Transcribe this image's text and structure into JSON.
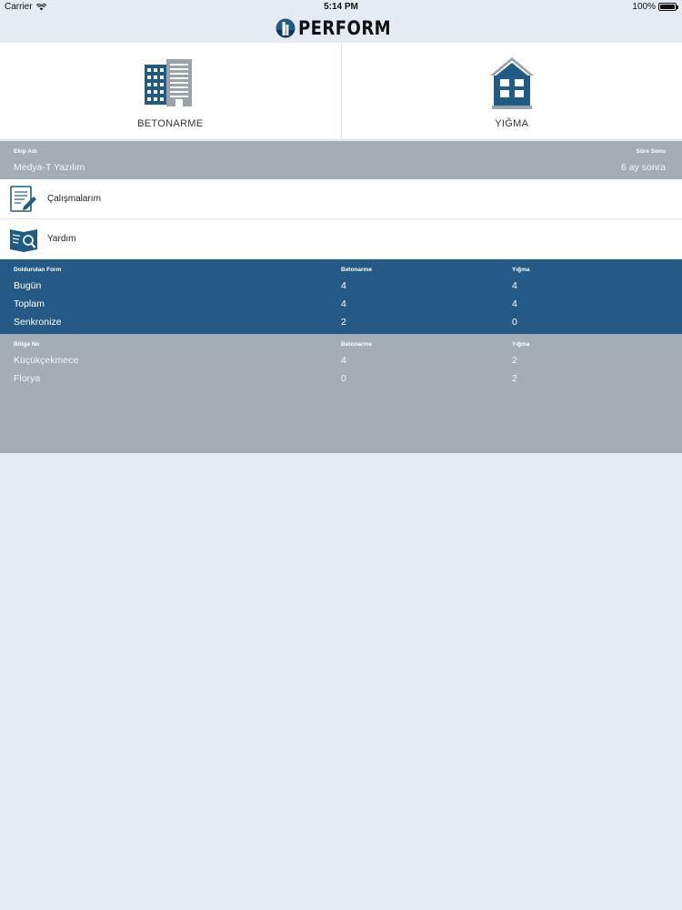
{
  "status_bar": {
    "carrier": "Carrier",
    "time": "5:14 PM",
    "battery": "100%",
    "battery_level": 1.0
  },
  "navbar": {
    "logo_text": "PERFORM",
    "logo_icon": "building-logo-icon"
  },
  "tiles": [
    {
      "label": "BETONARME",
      "icon": "office-building-icon"
    },
    {
      "label": "YIĞMA",
      "icon": "house-icon"
    }
  ],
  "team": {
    "name_label": "Ekip Adı",
    "name_value": "Medya-T Yazılım",
    "expiry_label": "Süre Sonu",
    "expiry_value": "6 ay sonra"
  },
  "menu": [
    {
      "label": "Çalışmalarım",
      "icon": "document-edit-icon"
    },
    {
      "label": "Yardım",
      "icon": "book-search-icon"
    }
  ],
  "form_stats": {
    "headers": [
      "Doldurulan Form",
      "Betonarme",
      "Yığma"
    ],
    "rows": [
      [
        "Bugün",
        "4",
        "4"
      ],
      [
        "Toplam",
        "4",
        "4"
      ],
      [
        "Senkronize",
        "2",
        "0"
      ]
    ]
  },
  "regions": {
    "headers": [
      "Bölge No",
      "Betonarme",
      "Yığma"
    ],
    "rows": [
      [
        "Küçükçekmece",
        "4",
        "2"
      ],
      [
        "Florya",
        "0",
        "2"
      ]
    ]
  },
  "colors": {
    "background": "#e6ebf1",
    "gray_band": "#a3adb3",
    "blue_band": "#265a86",
    "icon_blue": "#1f5b84",
    "icon_gray": "#9aa3a9"
  }
}
